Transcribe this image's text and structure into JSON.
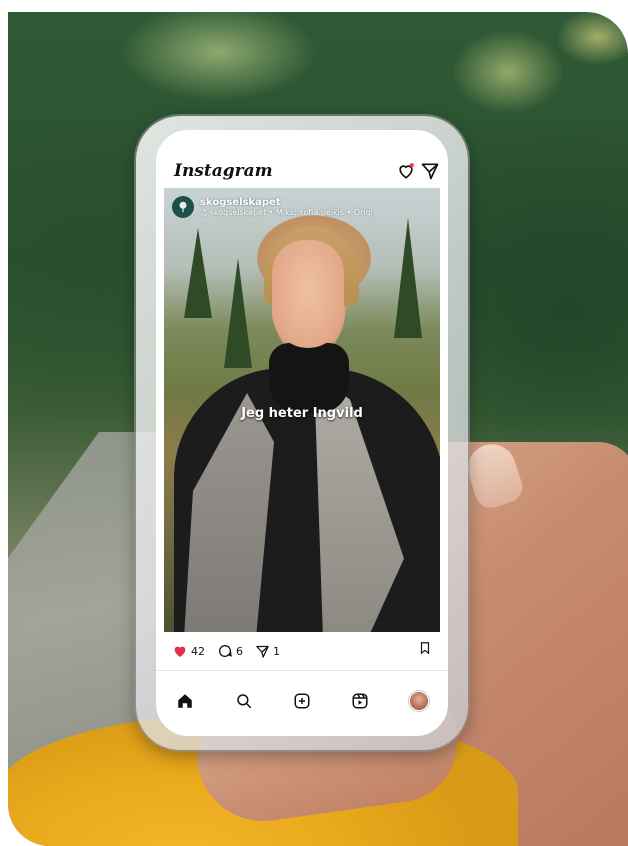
{
  "app": {
    "title": "Instagram"
  },
  "post": {
    "username": "skogselskapet",
    "audio": "skogselskapet • Miks: sofia.peikis • Origi",
    "caption": "Jeg heter Ingvild",
    "likes": "42",
    "comments": "6",
    "shares": "1"
  },
  "colors": {
    "like_red": "#e0304e",
    "notification_dot": "#ff3040"
  },
  "icons": {
    "header": [
      "heart-icon",
      "send-icon"
    ],
    "actions": [
      "heart-filled-icon",
      "comment-icon",
      "send-icon",
      "bookmark-icon"
    ],
    "tabs": [
      "home-icon",
      "search-icon",
      "create-icon",
      "reels-icon",
      "profile-avatar"
    ]
  }
}
